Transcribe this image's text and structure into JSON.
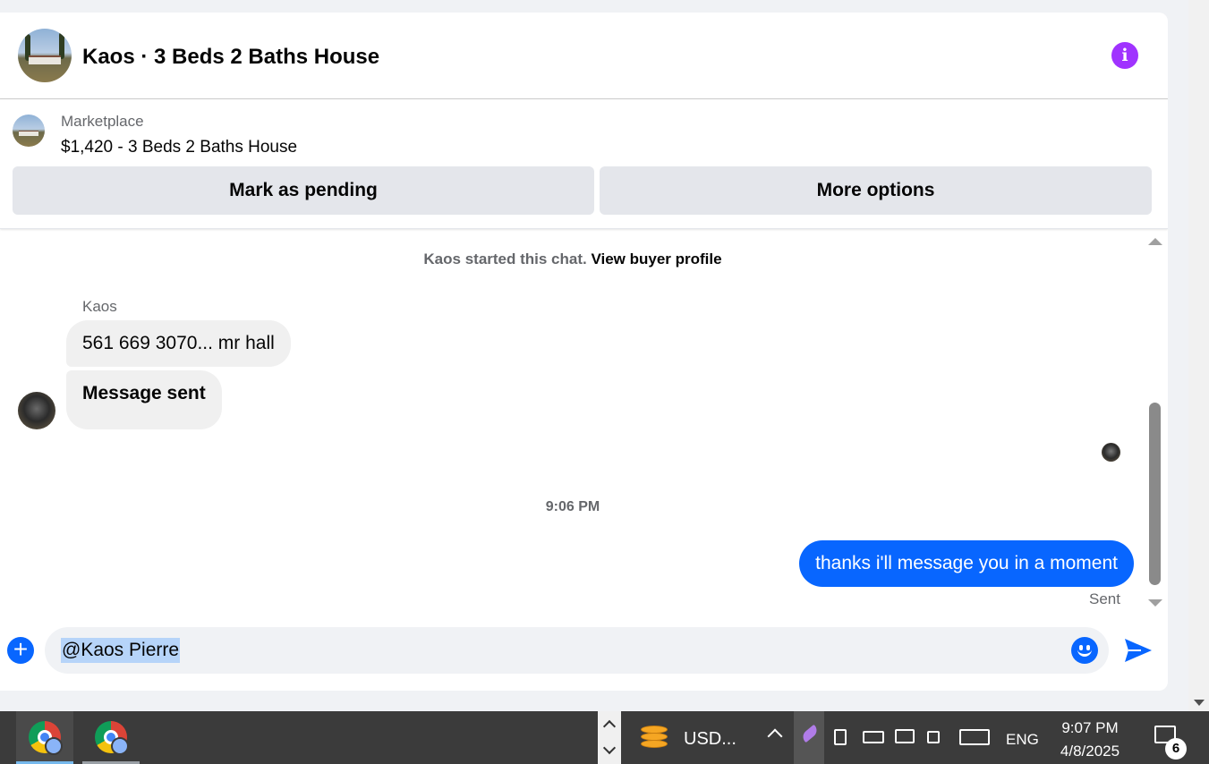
{
  "header": {
    "title": "Kaos · 3 Beds 2 Baths House",
    "info_label": "i"
  },
  "listing": {
    "source": "Marketplace",
    "title": "$1,420 - 3 Beds 2 Baths House",
    "mark_pending_label": "Mark as pending",
    "more_options_label": "More options"
  },
  "messages": {
    "started_text": "Kaos started this chat.",
    "view_profile_label": "View buyer profile",
    "sender_name": "Kaos",
    "incoming": [
      "561 669 3070... mr hall",
      "Message sent"
    ],
    "timestamp": "9:06 PM",
    "outgoing": "thanks i'll message you in a moment",
    "status": "Sent"
  },
  "composer": {
    "value": "@Kaos Pierre",
    "plus_label": "+"
  },
  "taskbar": {
    "widget_text": "USD...",
    "language": "ENG",
    "time": "9:07 PM",
    "date": "4/8/2025",
    "notification_count": "6"
  },
  "colors": {
    "accent_blue": "#0866ff",
    "info_purple": "#a033ff",
    "bubble_gray": "#f0f0f0"
  }
}
